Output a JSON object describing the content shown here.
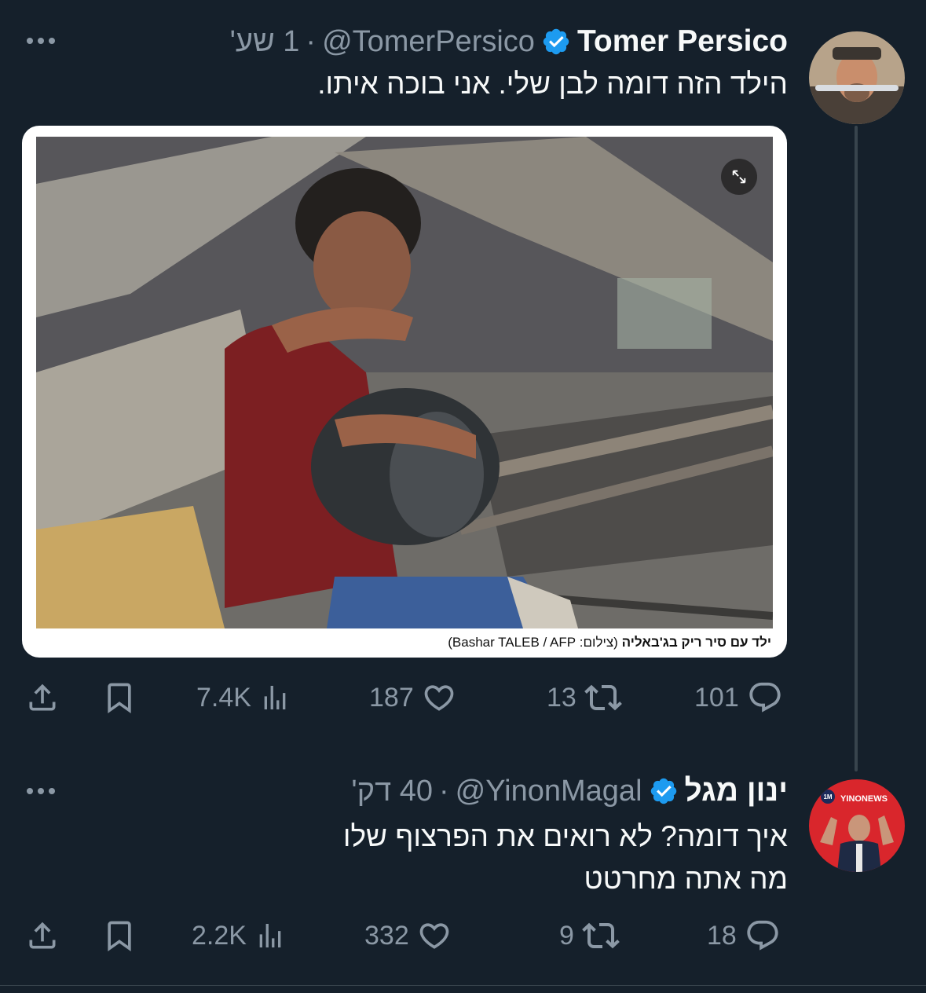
{
  "tweet1": {
    "name": "Tomer Persico",
    "handle": "@TomerPersico",
    "time": "1 שע'",
    "text": "הילד הזה דומה לבן שלי. אני בוכה איתו.",
    "media_caption_main": "ילד עם סיר ריק בג'באליה",
    "media_caption_credit": "(צילום: Bashar TALEB / AFP)",
    "stats": {
      "views": "7.4K",
      "likes": "187",
      "retweets": "13",
      "replies": "101"
    }
  },
  "tweet2": {
    "name": "ינון מגל",
    "handle": "@YinonMagal",
    "time": "40 דק'",
    "text_line1": "איך דומה? לא רואים את הפרצוף שלו",
    "text_line2": "מה אתה מחרטט",
    "avatar_badge": "1M",
    "avatar_brand": "YINONEWS",
    "stats": {
      "views": "2.2K",
      "likes": "332",
      "retweets": "9",
      "replies": "18"
    }
  },
  "icons": [
    "share-icon",
    "bookmark-icon",
    "views-icon",
    "like-icon",
    "retweet-icon",
    "reply-icon",
    "verified-icon",
    "more-icon",
    "expand-icon"
  ],
  "colors": {
    "background": "#15202b",
    "muted": "#8b98a5",
    "verified": "#1d9bf0",
    "divider": "#38444d"
  }
}
